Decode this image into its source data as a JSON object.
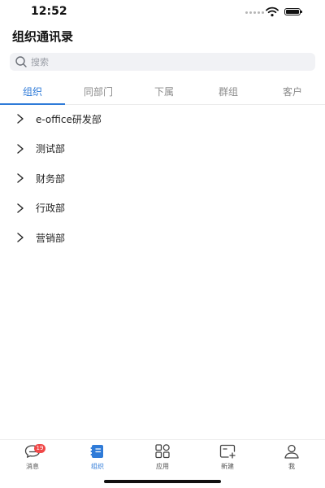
{
  "status_bar": {
    "time": "12:52"
  },
  "header": {
    "title": "组织通讯录"
  },
  "search": {
    "placeholder": "搜索"
  },
  "tabs": [
    {
      "label": "组织",
      "active": true
    },
    {
      "label": "同部门",
      "active": false
    },
    {
      "label": "下属",
      "active": false
    },
    {
      "label": "群组",
      "active": false
    },
    {
      "label": "客户",
      "active": false
    }
  ],
  "departments": [
    {
      "label": "e-office研发部",
      "icon": "chevron-right-icon"
    },
    {
      "label": "测试部",
      "icon": "chevron-right-icon"
    },
    {
      "label": "财务部",
      "icon": "chevron-right-icon"
    },
    {
      "label": "行政部",
      "icon": "chevron-right-icon"
    },
    {
      "label": "营销部",
      "icon": "chevron-right-icon"
    }
  ],
  "bottom_nav": [
    {
      "label": "消息",
      "icon": "chat-bubble-icon",
      "badge": "19",
      "active": false
    },
    {
      "label": "组织",
      "icon": "org-icon",
      "active": true
    },
    {
      "label": "应用",
      "icon": "apps-grid-icon",
      "active": false
    },
    {
      "label": "新建",
      "icon": "new-item-icon",
      "active": false
    },
    {
      "label": "我",
      "icon": "user-icon",
      "active": false
    }
  ],
  "colors": {
    "accent": "#2f7bd8",
    "badge": "#f04848",
    "search_bg": "#f1f2f5"
  }
}
